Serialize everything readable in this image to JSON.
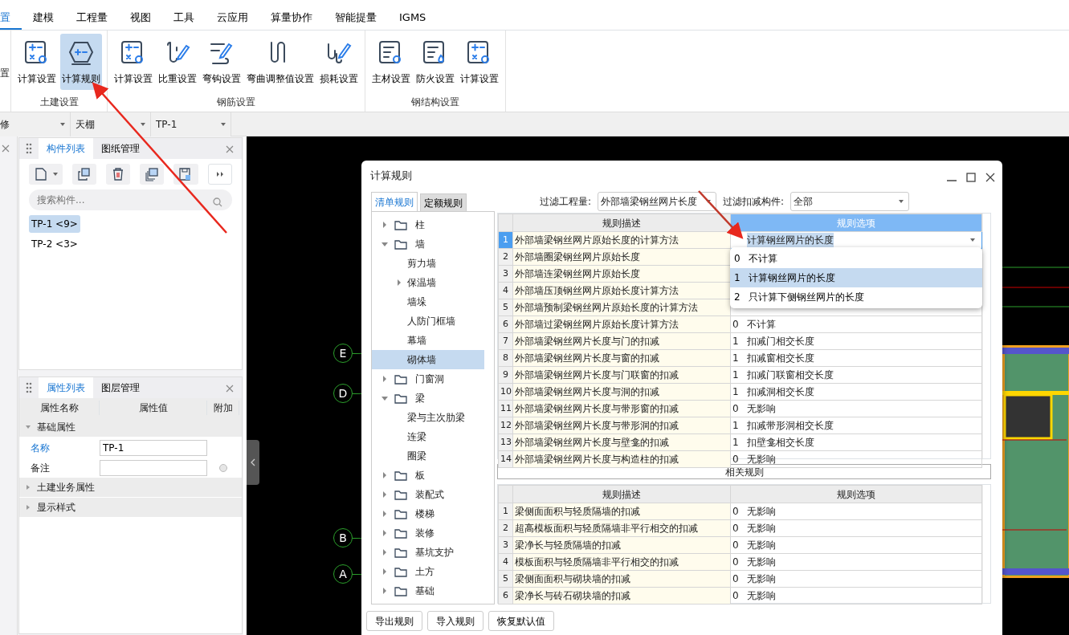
{
  "menu_tabs": [
    {
      "label": "置",
      "selected": true
    },
    {
      "label": "建模",
      "selected": false
    },
    {
      "label": "工程量",
      "selected": false
    },
    {
      "label": "视图",
      "selected": false
    },
    {
      "label": "工具",
      "selected": false
    },
    {
      "label": "云应用",
      "selected": false
    },
    {
      "label": "算量协作",
      "selected": false
    },
    {
      "label": "智能提量",
      "selected": false
    },
    {
      "label": "IGMS",
      "selected": false
    }
  ],
  "ribbon": {
    "partial_label": "置",
    "groups": [
      {
        "label": "土建设置",
        "buttons": [
          {
            "label": "计算设置",
            "selected": false
          },
          {
            "label": "计算规则",
            "selected": true
          }
        ]
      },
      {
        "label": "钢筋设置",
        "buttons": [
          {
            "label": "计算设置",
            "selected": false
          },
          {
            "label": "比重设置",
            "selected": false
          },
          {
            "label": "弯钩设置",
            "selected": false
          },
          {
            "label": "弯曲调整值设置",
            "selected": false
          },
          {
            "label": "损耗设置",
            "selected": false
          }
        ]
      },
      {
        "label": "钢结构设置",
        "buttons": [
          {
            "label": "主材设置",
            "selected": false
          },
          {
            "label": "防火设置",
            "selected": false
          },
          {
            "label": "计算设置",
            "selected": false
          }
        ]
      }
    ]
  },
  "toolbar_selects": [
    "修",
    "天棚",
    "TP-1"
  ],
  "component_panel": {
    "tabs": [
      {
        "label": "构件列表",
        "selected": true
      },
      {
        "label": "图纸管理",
        "selected": false
      }
    ],
    "search": {
      "placeholder": "搜索构件..."
    },
    "items": [
      {
        "label": "TP-1 <9>",
        "selected": true
      },
      {
        "label": "TP-2 <3>",
        "selected": false
      }
    ]
  },
  "property_panel": {
    "tabs": [
      {
        "label": "属性列表",
        "selected": true
      },
      {
        "label": "图层管理",
        "selected": false
      }
    ],
    "columns": [
      "属性名称",
      "属性值",
      "附加"
    ],
    "groups": [
      {
        "label": "基础属性",
        "expanded": true,
        "rows": [
          {
            "name": "名称",
            "value": "TP-1",
            "highlighted": true,
            "extra": false
          },
          {
            "name": "备注",
            "value": "",
            "highlighted": false,
            "extra": true
          }
        ]
      },
      {
        "label": "土建业务属性",
        "expanded": false
      },
      {
        "label": "显示样式",
        "expanded": false
      }
    ]
  },
  "axis_labels": [
    "E",
    "D",
    "B",
    "A"
  ],
  "dialog": {
    "title": "计算规则",
    "tabs": [
      {
        "label": "清单规则",
        "selected": true
      },
      {
        "label": "定额规则",
        "selected": false
      }
    ],
    "filters": [
      {
        "label": "过滤工程量:",
        "value": "外部墙梁钢丝网片长度"
      },
      {
        "label": "过滤扣减构件:",
        "value": "全部"
      }
    ],
    "tree": [
      {
        "label": "柱",
        "expanded": false,
        "selected": false
      },
      {
        "label": "墙",
        "expanded": true,
        "selected": false,
        "children": [
          {
            "label": "剪力墙",
            "selected": false
          },
          {
            "label": "保温墙",
            "expanded": false,
            "selected": false
          },
          {
            "label": "墙垛",
            "selected": false
          },
          {
            "label": "人防门框墙",
            "selected": false
          },
          {
            "label": "幕墙",
            "selected": false
          },
          {
            "label": "砌体墙",
            "selected": true
          }
        ]
      },
      {
        "label": "门窗洞",
        "expanded": false,
        "selected": false
      },
      {
        "label": "梁",
        "expanded": true,
        "selected": false,
        "children": [
          {
            "label": "梁与主次肋梁",
            "selected": false
          },
          {
            "label": "连梁",
            "selected": false
          },
          {
            "label": "圈梁",
            "selected": false
          }
        ]
      },
      {
        "label": "板",
        "expanded": false,
        "selected": false
      },
      {
        "label": "装配式",
        "expanded": false,
        "selected": false
      },
      {
        "label": "楼梯",
        "expanded": false,
        "selected": false
      },
      {
        "label": "装修",
        "expanded": false,
        "selected": false
      },
      {
        "label": "基坑支护",
        "expanded": false,
        "selected": false
      },
      {
        "label": "土方",
        "expanded": false,
        "selected": false
      },
      {
        "label": "基础",
        "expanded": false,
        "selected": false
      }
    ],
    "rules_table": {
      "columns": [
        "规则描述",
        "规则选项"
      ],
      "rows": [
        {
          "num": "1",
          "description": "外部墙梁钢丝网片原始长度的计算方法",
          "selected": true,
          "option": {
            "text": "计算钢丝网片的长度"
          }
        },
        {
          "num": "2",
          "description": "外部墙圈梁钢丝网片原始长度",
          "selected": false
        },
        {
          "num": "3",
          "description": "外部墙连梁钢丝网片原始长度",
          "selected": false
        },
        {
          "num": "4",
          "description": "外部墙压顶钢丝网片原始长度计算方法",
          "selected": false
        },
        {
          "num": "5",
          "description": "外部墙预制梁钢丝网片原始长度的计算方法",
          "selected": false
        },
        {
          "num": "6",
          "description": "外部墙过梁钢丝网片原始长度计算方法",
          "selected": false,
          "option": {
            "code": "0",
            "text": "不计算"
          }
        },
        {
          "num": "7",
          "description": "外部墙梁钢丝网片长度与门的扣减",
          "selected": false,
          "option": {
            "code": "1",
            "text": "扣减门相交长度"
          }
        },
        {
          "num": "8",
          "description": "外部墙梁钢丝网片长度与窗的扣减",
          "selected": false,
          "option": {
            "code": "1",
            "text": "扣减窗相交长度"
          }
        },
        {
          "num": "9",
          "description": "外部墙梁钢丝网片长度与门联窗的扣减",
          "selected": false,
          "option": {
            "code": "1",
            "text": "扣减门联窗相交长度"
          }
        },
        {
          "num": "10",
          "description": "外部墙梁钢丝网片长度与洞的扣减",
          "selected": false,
          "option": {
            "code": "1",
            "text": "扣减洞相交长度"
          }
        },
        {
          "num": "11",
          "description": "外部墙梁钢丝网片长度与带形窗的扣减",
          "selected": false,
          "option": {
            "code": "0",
            "text": "无影响"
          }
        },
        {
          "num": "12",
          "description": "外部墙梁钢丝网片长度与带形洞的扣减",
          "selected": false,
          "option": {
            "code": "1",
            "text": "扣减带形洞相交长度"
          }
        },
        {
          "num": "13",
          "description": "外部墙梁钢丝网片长度与壁龛的扣减",
          "selected": false,
          "option": {
            "code": "1",
            "text": "扣壁龛相交长度"
          }
        },
        {
          "num": "14",
          "description": "外部墙梁钢丝网片长度与构造柱的扣减",
          "selected": false,
          "option": {
            "code": "0",
            "text": "无影响"
          }
        }
      ],
      "open_dropdown": [
        {
          "code": "0",
          "text": "不计算",
          "selected": false
        },
        {
          "code": "1",
          "text": "计算钢丝网片的长度",
          "selected": true
        },
        {
          "code": "2",
          "text": "只计算下侧钢丝网片的长度",
          "selected": false
        }
      ]
    },
    "related_label": "相关规则",
    "related_table": {
      "columns": [
        "规则描述",
        "规则选项"
      ],
      "rows": [
        {
          "num": "1",
          "description": "梁侧面面积与轻质隔墙的扣减",
          "option": {
            "code": "0",
            "text": "无影响"
          }
        },
        {
          "num": "2",
          "description": "超高模板面积与轻质隔墙非平行相交的扣减",
          "option": {
            "code": "0",
            "text": "无影响"
          }
        },
        {
          "num": "3",
          "description": "梁净长与轻质隔墙的扣减",
          "option": {
            "code": "0",
            "text": "无影响"
          }
        },
        {
          "num": "4",
          "description": "模板面积与轻质隔墙非平行相交的扣减",
          "option": {
            "code": "0",
            "text": "无影响"
          }
        },
        {
          "num": "5",
          "description": "梁侧面面积与砌块墙的扣减",
          "option": {
            "code": "0",
            "text": "无影响"
          }
        },
        {
          "num": "6",
          "description": "梁净长与砖石砌块墙的扣减",
          "option": {
            "code": "0",
            "text": "无影响"
          }
        }
      ]
    },
    "buttons": [
      "导出规则",
      "导入规则",
      "恢复默认值"
    ]
  }
}
